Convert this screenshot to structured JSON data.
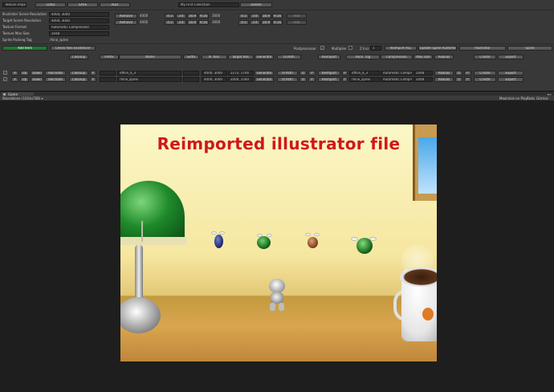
{
  "toolbar": {
    "dropdown": "Texture Import",
    "load": "LOAD",
    "save": "SAVE",
    "add": "ADD",
    "collection": "My First Collection",
    "delete": "Delete"
  },
  "settings": {
    "illustrator_res_label": "Illustrator Scene Resolution",
    "illustrator_res_value": "4000, 3000",
    "target_res_label": "Target Scene Resolution",
    "target_res_value": "4000, 3000",
    "texture_format_label": "Texture Format",
    "texture_format_value": "Automatic Compressed",
    "texture_max_label": "Texture Max Size",
    "texture_max_value": "2048",
    "packing_tag_label": "Sprite Packing Tag",
    "packing_tag_value": "rhino_spine",
    "remove": "Remove",
    "res_value": "4000",
    "res_value2": "3000",
    "ratios": [
      "4:3",
      "3:4",
      "16:9",
      "9:16"
    ],
    "add_label": "Add"
  },
  "actions": {
    "add_item": "Add Item",
    "check_files": "Check files existence?",
    "postprocessor": "Postprocessor",
    "multiplier": "Multiplier",
    "z_incr_label": "Z Incr.",
    "z_incr_value": "1",
    "reimport_all": "Reimport ALL",
    "update_spine": "Update Spine Runtime",
    "illustrator": "Illustrator",
    "spine": "Spine"
  },
  "columns": {
    "cleanup": "Cleanup",
    "prefix": "Prefix",
    "name": "Name",
    "suffix": "Suffix",
    "ill_res": "Ill. Res.",
    "target_res": "Target Res.",
    "generate": "Generate",
    "ill_path": "Ill.Path",
    "reimport": "Reimport",
    "pack_tag": "Pack. Tag",
    "compression": "Compression",
    "max_size": "Max size",
    "realias": "Realias",
    "create": "Create",
    "export": "Export"
  },
  "rows": [
    {
      "name": "office_4_3",
      "ill_res": "4000, 3000",
      "target_res": "2272, 1704",
      "pack_tag": "office_4_3",
      "compression": "Automatic Compres",
      "max_size": "2048"
    },
    {
      "name": "rhino_spine",
      "ill_res": "4000, 3000",
      "target_res": "2000, 1500",
      "pack_tag": "rhino_spine",
      "compression": "Automatic Compres",
      "max_size": "2048"
    }
  ],
  "row_buttons": {
    "x": "X",
    "up": "Up",
    "down": "Down",
    "recreate": "Recreate",
    "cleanup": "Cleanup",
    "p": "P",
    "generate": "Generate",
    "ill_path": "Ill.Path",
    "o": "O",
    "pr": "P",
    "reimport": "Reimport",
    "realias": "Realias",
    "q": "O",
    "r": "P",
    "create": "Create",
    "export": "Export"
  },
  "game": {
    "tab": "Game",
    "resolution": "Standalone (1024x768)",
    "maximize": "Maximize on Play",
    "stats": "Stats",
    "gizmos": "Gizmos"
  },
  "scene": {
    "headline": "Reimported illustrator file"
  }
}
